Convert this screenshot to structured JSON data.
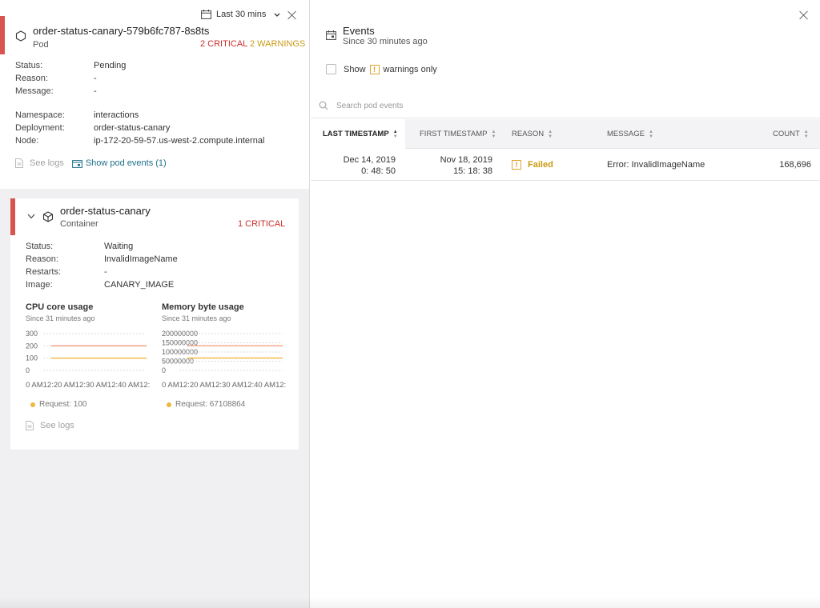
{
  "pod": {
    "time_range": "Last 30 mins",
    "name": "order-status-canary-579b6fc787-8s8ts",
    "kind": "Pod",
    "critical": "2 CRITICAL",
    "warnings": "2 WARNINGS",
    "fields": [
      {
        "key": "Status:",
        "value": "Pending"
      },
      {
        "key": "Reason:",
        "value": "-"
      },
      {
        "key": "Message:",
        "value": "-"
      }
    ],
    "meta": [
      {
        "key": "Namespace:",
        "value": "interactions"
      },
      {
        "key": "Deployment:",
        "value": "order-status-canary"
      },
      {
        "key": "Node:",
        "value": "ip-172-20-59-57.us-west-2.compute.internal"
      }
    ],
    "see_logs": "See logs",
    "show_events": "Show pod events (1)"
  },
  "container": {
    "name": "order-status-canary",
    "kind": "Container",
    "critical": "1 CRITICAL",
    "fields": [
      {
        "key": "Status:",
        "value": "Waiting"
      },
      {
        "key": "Reason:",
        "value": "InvalidImageName"
      },
      {
        "key": "Restarts:",
        "value": "-"
      },
      {
        "key": "Image:",
        "value": "CANARY_IMAGE"
      }
    ],
    "see_logs": "See logs"
  },
  "chart_data": [
    {
      "type": "line",
      "title": "CPU core usage",
      "subtitle": "Since 31 minutes ago",
      "yticks": [
        "300",
        "200",
        "100",
        "0"
      ],
      "ylim": [
        0,
        300
      ],
      "xticks": "0 AM12:20 AM12:30 AM12:40 AM12:",
      "series": [
        {
          "value": 200,
          "color": "#f0997a"
        },
        {
          "name": "Request: 100",
          "value": 100,
          "color": "#f0b73c"
        }
      ],
      "legend": "Request: 100"
    },
    {
      "type": "line",
      "title": "Memory byte usage",
      "subtitle": "Since 31 minutes ago",
      "yticks": [
        "200000000",
        "150000000",
        "100000000",
        "50000000",
        "0"
      ],
      "ylim": [
        0,
        200000000
      ],
      "xticks": "0 AM12:20 AM12:30 AM12:40 AM12:",
      "series": [
        {
          "value": 134217728,
          "color": "#f0997a"
        },
        {
          "name": "Request: 67108864",
          "value": 67108864,
          "color": "#f0b73c"
        }
      ],
      "legend": "Request: 67108864"
    }
  ],
  "events": {
    "title": "Events",
    "subtitle": "Since 30 minutes ago",
    "show_label": "Show",
    "warnings_only_label": "warnings only",
    "search_placeholder": "Search pod events",
    "columns": [
      "LAST TIMESTAMP",
      "FIRST TIMESTAMP",
      "REASON",
      "MESSAGE",
      "COUNT"
    ],
    "rows": [
      {
        "last_date": "Dec 14, 2019",
        "last_time": "0: 48: 50",
        "first_date": "Nov 18, 2019",
        "first_time": "15: 18: 38",
        "reason": "Failed",
        "message": "Error: InvalidImageName",
        "count": "168,696"
      }
    ]
  },
  "colors": {
    "critical": "#c9302c",
    "warning": "#c99a14",
    "accent_bar": "#d9534f",
    "link": "#1f6f8b"
  }
}
